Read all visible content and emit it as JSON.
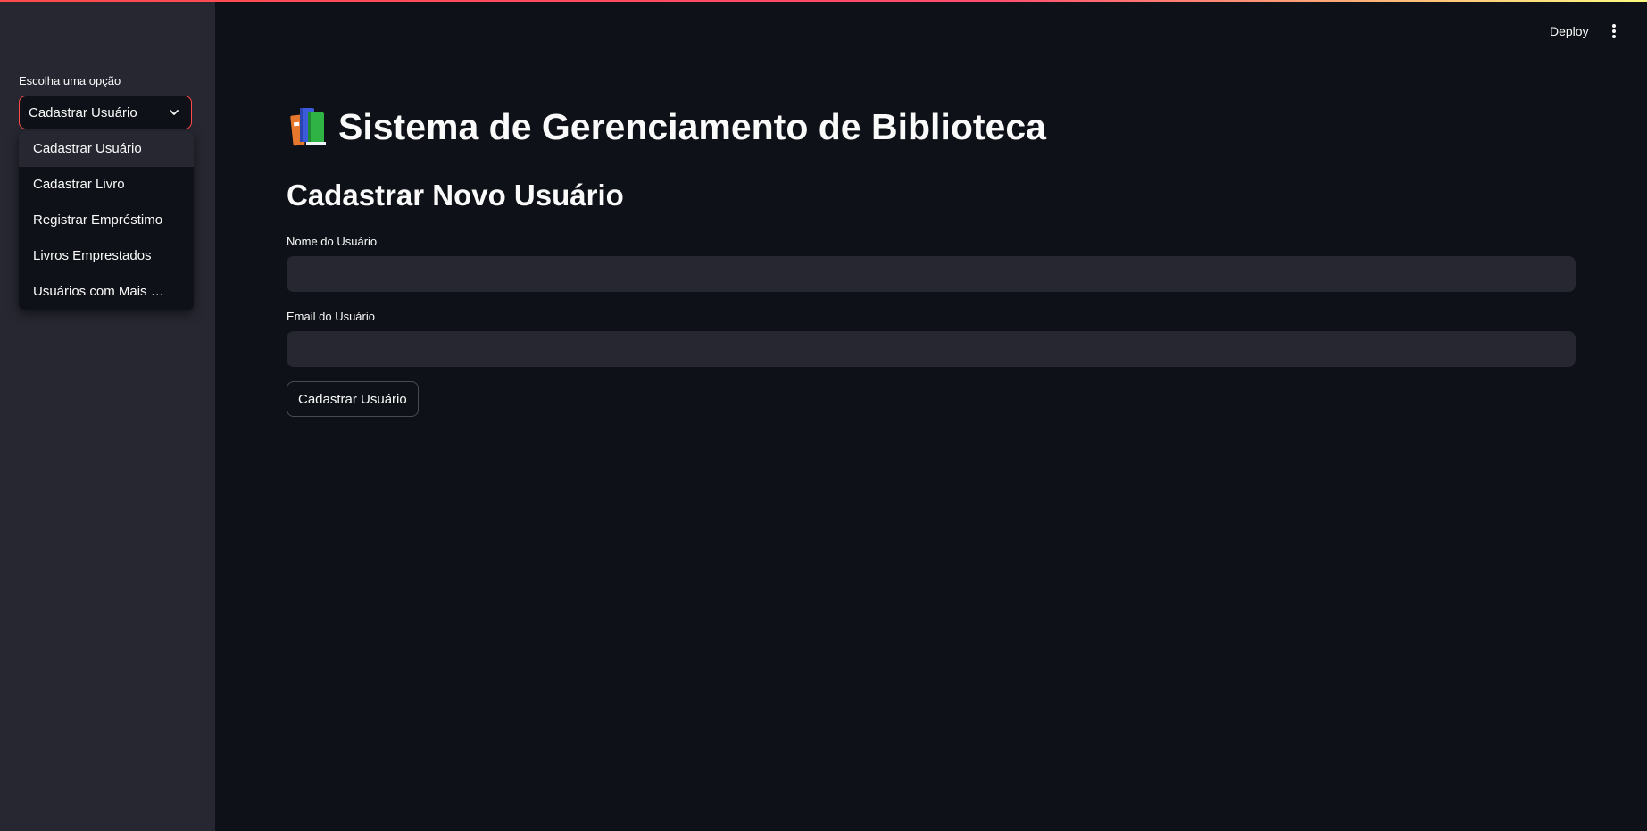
{
  "sidebar": {
    "select_label": "Escolha uma opção",
    "selected_value": "Cadastrar Usuário",
    "options": [
      "Cadastrar Usuário",
      "Cadastrar Livro",
      "Registrar Empréstimo",
      "Livros Emprestados",
      "Usuários com Mais E…"
    ]
  },
  "header": {
    "deploy_label": "Deploy",
    "menu_icon": "kebab-menu-icon"
  },
  "main": {
    "title_icon": "books-icon",
    "title": "Sistema de Gerenciamento de Biblioteca",
    "subtitle": "Cadastrar Novo Usuário",
    "name_label": "Nome do Usuário",
    "name_value": "",
    "email_label": "Email do Usuário",
    "email_value": "",
    "submit_label": "Cadastrar Usuário"
  },
  "colors": {
    "background": "#0e1117",
    "sidebar": "#262730",
    "accent": "#ff4b4b",
    "text": "#fafafa"
  }
}
